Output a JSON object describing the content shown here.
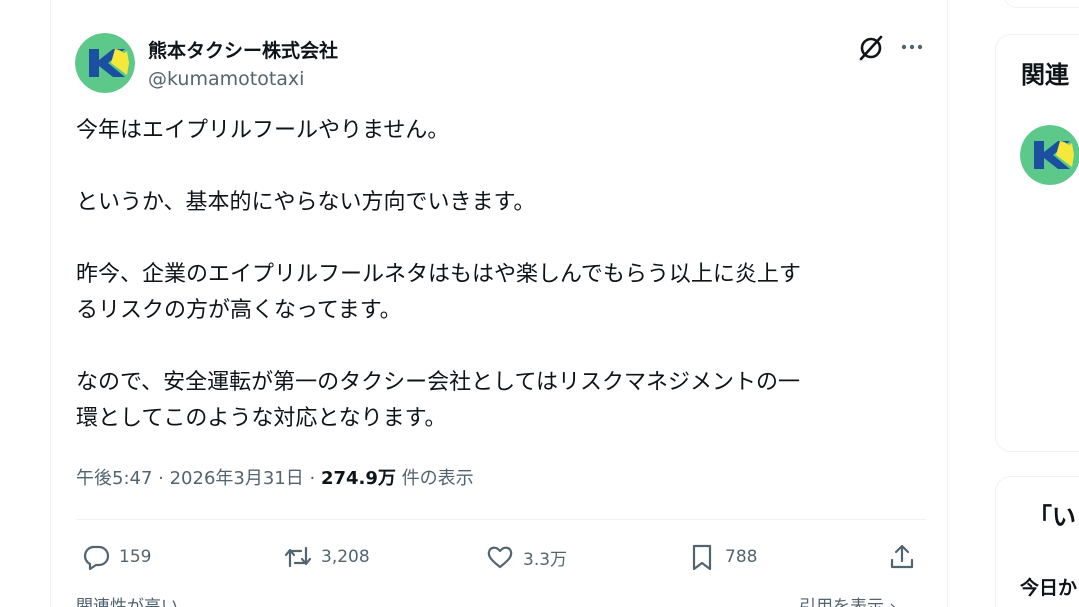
{
  "tweet": {
    "display_name": "熊本タクシー株式会社",
    "handle": "@kumamototaxi",
    "text": "今年はエイプリルフールやりません。\n\nというか、基本的にやらない方向でいきます。\n\n昨今、企業のエイプリルフールネタはもはや楽しんでもらう以上に炎上す\nるリスクの方が高くなってます。\n\nなので、安全運転が第一のタクシー会社としてはリスクマネジメントの一\n環としてこのような対応となります。",
    "time": "午後5:47",
    "date": "2026年3月31日",
    "separator": " · ",
    "views_count": "274.9万",
    "views_label": " 件の表示"
  },
  "actions": {
    "reply_count": "159",
    "retweet_count": "3,208",
    "like_count": "3.3万",
    "bookmark_count": "788"
  },
  "footer": {
    "relevance_label": "関連性が高い ⌄",
    "view_quotes_label": "引用を表示 ›"
  },
  "sidebar": {
    "related_title": "関連",
    "trend_title": "「い",
    "trend_subtitle": "今日か"
  },
  "icons": {
    "avatar": "kumamoto-taxi-logo",
    "grok": "grok-icon",
    "more": "more-icon",
    "reply": "reply-icon",
    "retweet": "retweet-icon",
    "like": "like-icon",
    "bookmark": "bookmark-icon",
    "share": "share-icon"
  },
  "colors": {
    "text_primary": "#0f1419",
    "text_secondary": "#536471",
    "divider": "#eff3f4",
    "logo_green": "#5cc98a",
    "logo_blue": "#1b4fa0",
    "logo_yellow": "#f6e83a"
  }
}
